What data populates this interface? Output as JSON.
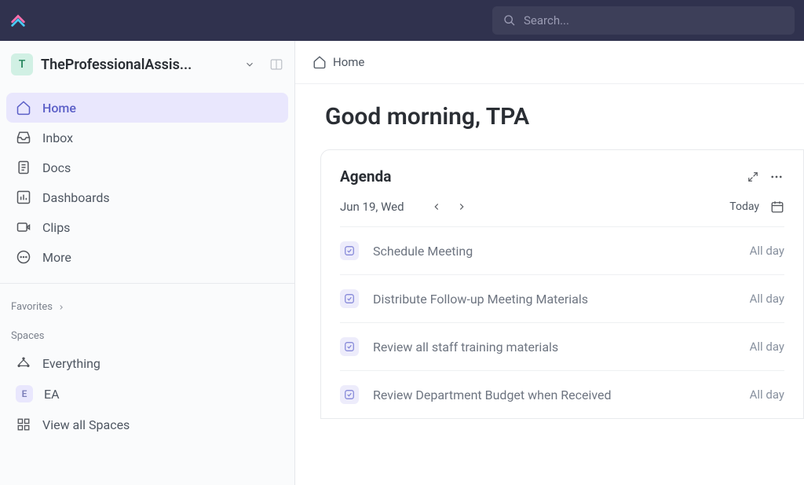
{
  "search": {
    "placeholder": "Search..."
  },
  "workspace": {
    "avatar_letter": "T",
    "name": "TheProfessionalAssis..."
  },
  "nav": {
    "home": "Home",
    "inbox": "Inbox",
    "docs": "Docs",
    "dashboards": "Dashboards",
    "clips": "Clips",
    "more": "More"
  },
  "sections": {
    "favorites": "Favorites",
    "spaces": "Spaces"
  },
  "spaces": {
    "everything": "Everything",
    "ea_letter": "E",
    "ea_label": "EA",
    "view_all": "View all Spaces"
  },
  "breadcrumb": {
    "home": "Home"
  },
  "greeting": "Good morning, TPA",
  "agenda": {
    "title": "Agenda",
    "date": "Jun 19, Wed",
    "today": "Today",
    "tasks": [
      {
        "title": "Schedule Meeting",
        "time": "All day"
      },
      {
        "title": "Distribute Follow-up Meeting Materials",
        "time": "All day"
      },
      {
        "title": "Review all staff training materials",
        "time": "All day"
      },
      {
        "title": "Review Department Budget when Received",
        "time": "All day"
      }
    ]
  }
}
